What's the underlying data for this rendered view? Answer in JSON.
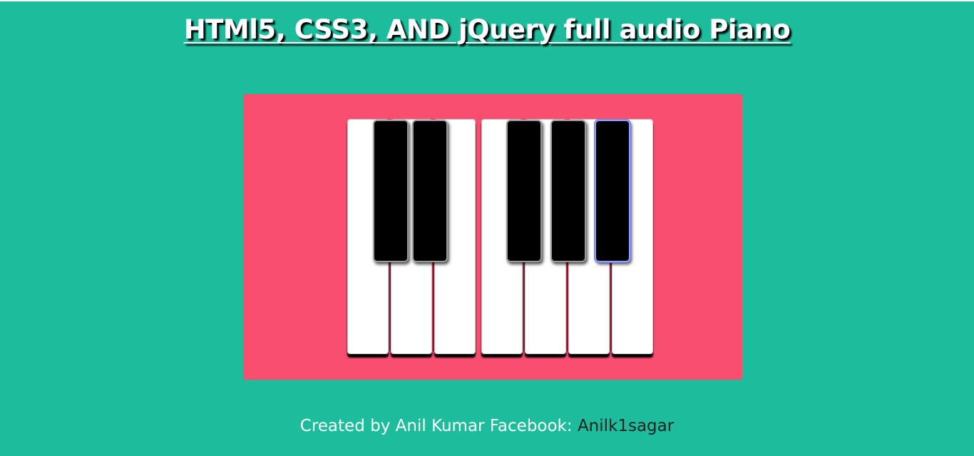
{
  "page": {
    "title": "HTMl5, CSS3, AND jQuery full audio Piano"
  },
  "piano": {
    "panel_color": "#f84f70",
    "background_color": "#1dbc9c",
    "white_keys": [
      {
        "name": "white-key-1"
      },
      {
        "name": "white-key-2"
      },
      {
        "name": "white-key-3"
      },
      {
        "name": "white-key-4"
      },
      {
        "name": "white-key-5"
      },
      {
        "name": "white-key-6"
      },
      {
        "name": "white-key-7"
      }
    ],
    "black_keys": [
      {
        "name": "black-key-1"
      },
      {
        "name": "black-key-2"
      },
      {
        "name": "black-key-3"
      },
      {
        "name": "black-key-4"
      },
      {
        "name": "black-key-5",
        "focused": true
      }
    ]
  },
  "footer": {
    "credit_text": "Created by Anil Kumar Facebook: ",
    "facebook_link": "Anilk1sagar"
  }
}
